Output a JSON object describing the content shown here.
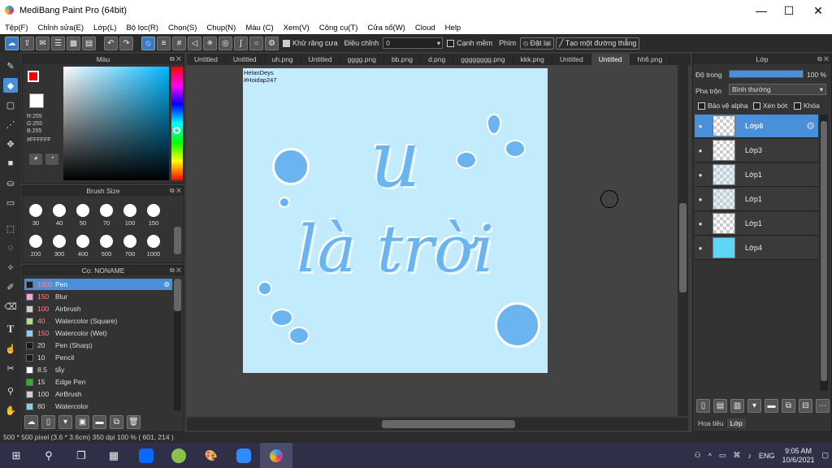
{
  "window": {
    "title": "MediBang Paint Pro (64bit)",
    "minimize": "—",
    "maximize": "☐",
    "close": "✕"
  },
  "menu": [
    "Tệp(F)",
    "Chỉnh sửa(E)",
    "Lớp(L)",
    "Bộ lọc(R)",
    "Chọn(S)",
    "Chụp(N)",
    "Màu (C)",
    "Xem(V)",
    "Công cụ(T)",
    "Cửa sổ(W)",
    "Cloud",
    "Help"
  ],
  "toolbar": {
    "antialias_label": "Khử răng cưa",
    "adjust_label": "Điều chỉnh",
    "adjust_value": "0",
    "edge_label": "Cạnh mềm",
    "key_label": "Phím",
    "reset_label": "Đặt lại",
    "line_label": "Tạo một đường thẳng"
  },
  "color_panel": {
    "title": "Màu",
    "rgb": "R:255\nG:255\nB:255",
    "hex": "#FFFFFF"
  },
  "brush_size": {
    "title": "Brush Size",
    "row1": [
      "30",
      "40",
      "50",
      "70",
      "100",
      "150"
    ],
    "row2": [
      "200",
      "300",
      "400",
      "500",
      "700",
      "1000"
    ]
  },
  "brush_list": {
    "title": "Cọ: NONAME",
    "items": [
      {
        "size": "1000",
        "name": "Pen",
        "color": "#1a1a1a"
      },
      {
        "size": "150",
        "name": "Blur",
        "color": "#f3a6d6"
      },
      {
        "size": "100",
        "name": "Airbrush",
        "color": "#cfcfcf"
      },
      {
        "size": "40",
        "name": "Watercolor (Square)",
        "color": "#b6e17a"
      },
      {
        "size": "150",
        "name": "Watercolor (Wet)",
        "color": "#7dd6f0"
      },
      {
        "size": "20",
        "name": "Pen (Sharp)",
        "color": "#1a1a1a"
      },
      {
        "size": "10",
        "name": "Pencil",
        "color": "#1a1a1a"
      },
      {
        "size": "8.5",
        "name": "tẩy",
        "color": "#ffffff"
      },
      {
        "size": "15",
        "name": "Edge Pen",
        "color": "#22bb22"
      },
      {
        "size": "100",
        "name": "AirBrush",
        "color": "#cfcfcf"
      },
      {
        "size": "80",
        "name": "Watercolor",
        "color": "#7dd6f0"
      }
    ]
  },
  "tabs": [
    "Untitled",
    "Untitled",
    "uh.png",
    "Untitled",
    "gggg.png",
    "bb.png",
    "d.png",
    "gggggggg.png",
    "kkk.png",
    "Untitled",
    "Untitled",
    "hh6.png"
  ],
  "canvas": {
    "watermark": "HelanDeys\n#Hoidap247",
    "line1": "u",
    "line2": "là trời"
  },
  "layers": {
    "title": "Lớp",
    "opacity_label": "Độ trong",
    "opacity_value": "100 %",
    "opacity": 1.0,
    "blend_label": "Pha trộn",
    "blend_value": "Bình thường",
    "protect_alpha": "Bảo vệ alpha",
    "clip": "Xén bớt",
    "lock": "Khóa",
    "items": [
      "Lớp6",
      "Lớp3",
      "Lớp1",
      "Lớp1",
      "Lớp1",
      "Lớp4"
    ],
    "bottom_tabs": [
      "Hoa tiêu",
      "Lớp"
    ]
  },
  "status": "500 * 500 pixel   (3.6 * 3.6cm)   350 dpi   100 %   ( 601, 214 )",
  "taskbar": {
    "time": "9:05 AM",
    "date": "10/6/2021",
    "lang": "ENG"
  }
}
